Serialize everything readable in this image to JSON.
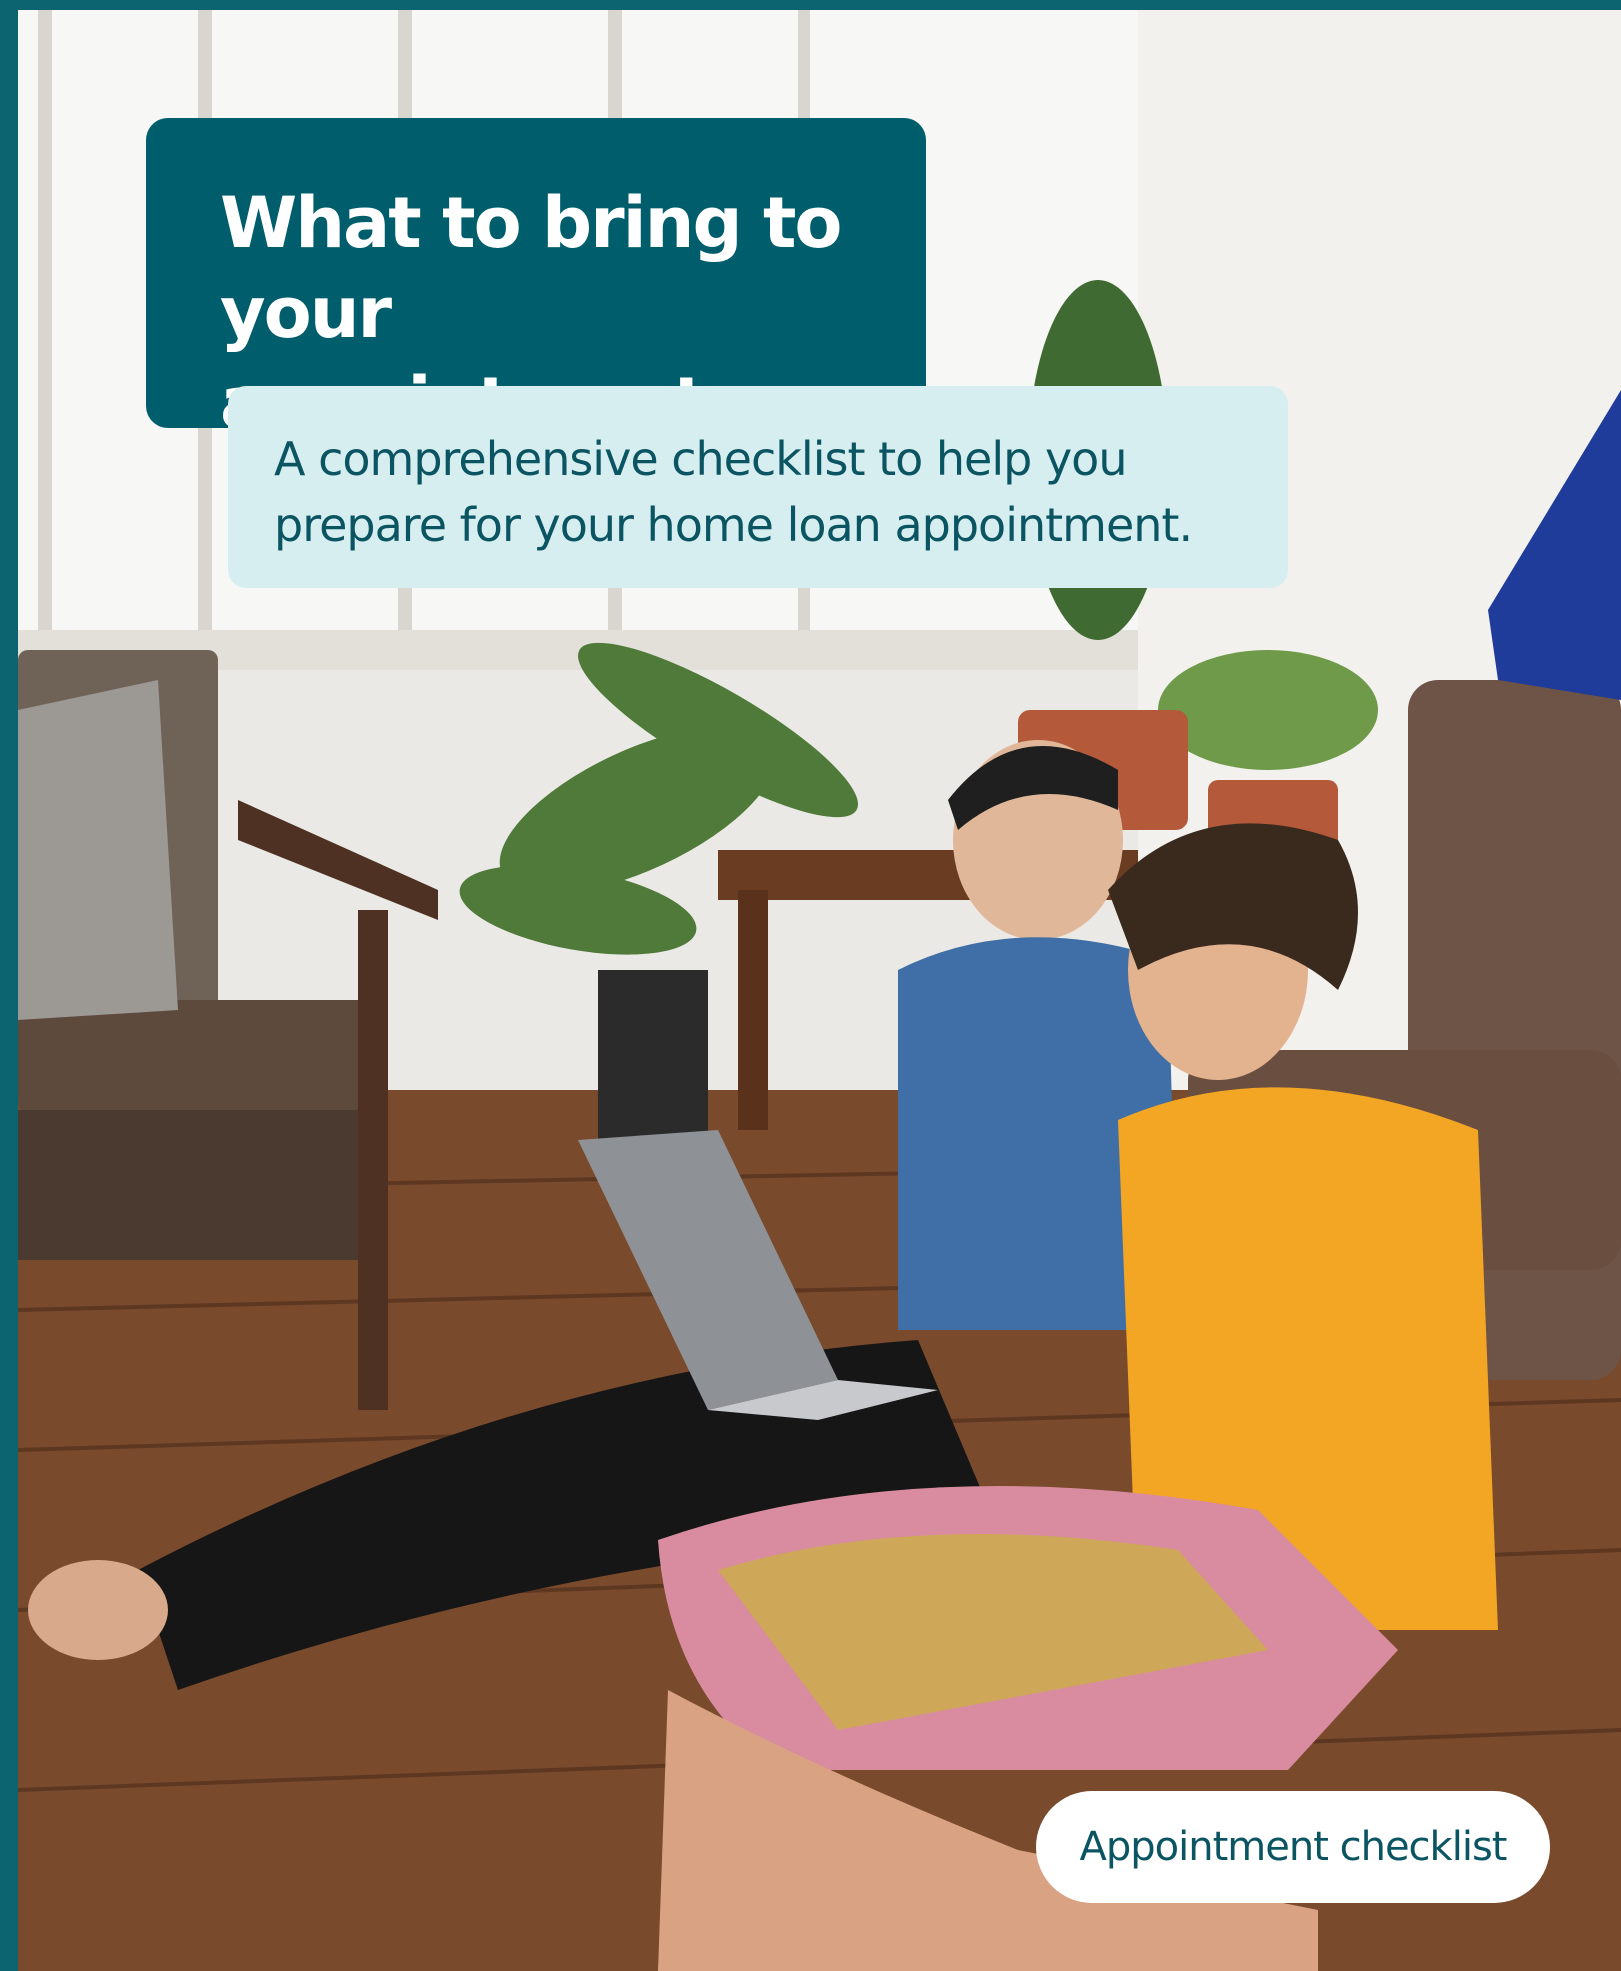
{
  "header": {
    "title": "What to bring to your appointment",
    "subtitle": "A comprehensive checklist to help you prepare for your home loan appointment."
  },
  "cta": {
    "label": "Appointment checklist"
  },
  "colors": {
    "frame_teal": "#0b6470",
    "title_box": "#005e6c",
    "subtitle_box": "#d7eef1",
    "text_teal": "#0b5563"
  }
}
